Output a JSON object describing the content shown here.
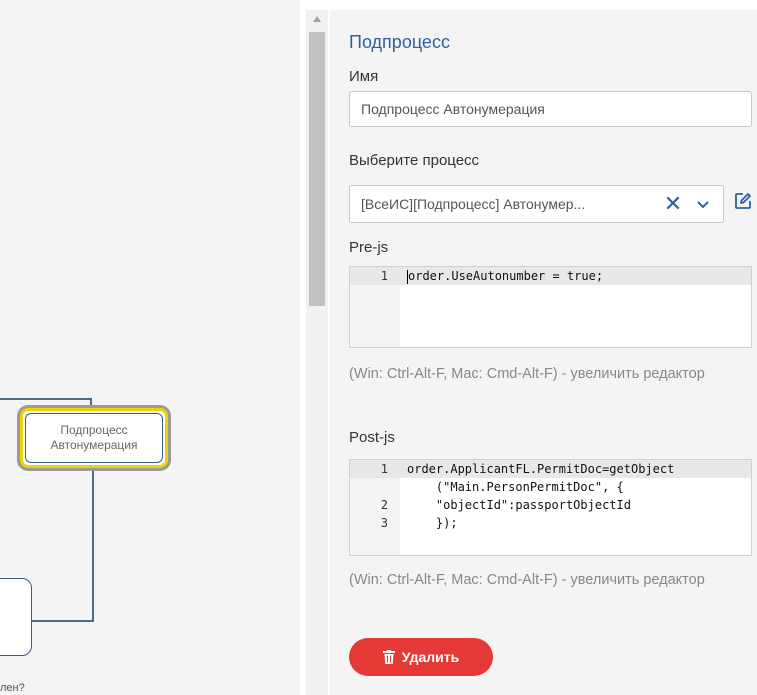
{
  "canvas": {
    "node_label_line1": "Подпроцесс",
    "node_label_line2": "Автонумерация",
    "partial_text": "лен?"
  },
  "panel": {
    "title": "Подпроцесс",
    "name_label": "Имя",
    "name_value": "Подпроцесс Автонумерация",
    "process_label": "Выберите процесс",
    "process_value": "[ВсеИС][Подпроцесс] Автонумер...",
    "clear_icon": "✕",
    "pre_js_label": "Pre-js",
    "pre_js_lines": [
      {
        "num": "1",
        "text": "order.UseAutonumber = true;"
      }
    ],
    "post_js_label": "Post-js",
    "post_js_lines": [
      {
        "num": "1",
        "text": "order.ApplicantFL.PermitDoc=getObject"
      },
      {
        "num": "",
        "text": "    (\"Main.PersonPermitDoc\", {"
      },
      {
        "num": "2",
        "text": "    \"objectId\":passportObjectId"
      },
      {
        "num": "3",
        "text": "    });"
      }
    ],
    "hint_text": "(Win: Ctrl-Alt-F, Mac: Cmd-Alt-F) - увеличить редактор",
    "delete_label": "Удалить"
  },
  "colors": {
    "accent": "#2f5fa0",
    "danger": "#e53935",
    "node_highlight": "#f2d100"
  }
}
